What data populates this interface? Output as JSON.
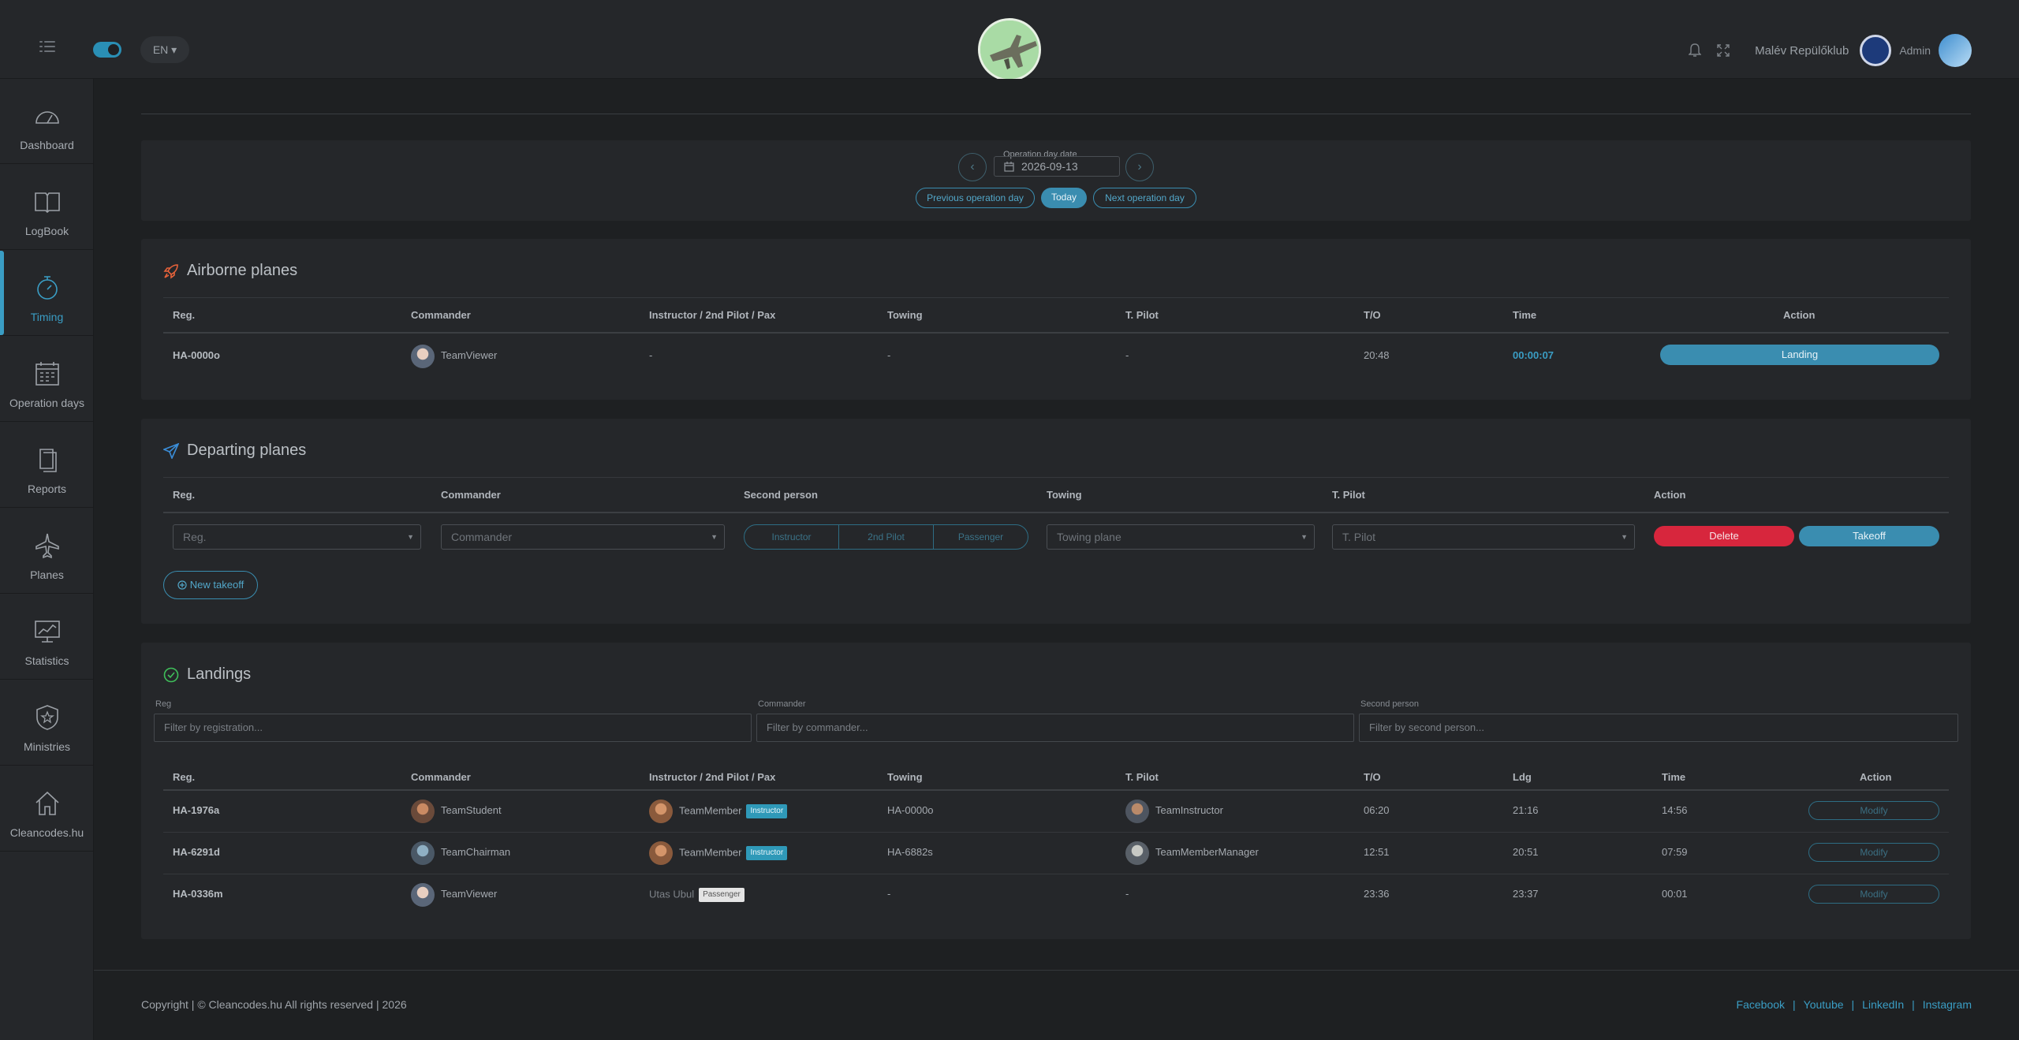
{
  "topbar": {
    "language": "EN",
    "club_name": "Malév Repülőklub",
    "user_role": "Admin"
  },
  "sidebar": {
    "items": [
      {
        "label": "Dashboard",
        "icon": "gauge-icon",
        "active": false
      },
      {
        "label": "LogBook",
        "icon": "book-icon",
        "active": false
      },
      {
        "label": "Timing",
        "icon": "stopwatch-icon",
        "active": true
      },
      {
        "label": "Operation days",
        "icon": "calendar-icon",
        "active": false
      },
      {
        "label": "Reports",
        "icon": "documents-icon",
        "active": false
      },
      {
        "label": "Planes",
        "icon": "plane-icon",
        "active": false
      },
      {
        "label": "Statistics",
        "icon": "chart-monitor-icon",
        "active": false
      },
      {
        "label": "Ministries",
        "icon": "shield-star-icon",
        "active": false
      },
      {
        "label": "Cleancodes.hu",
        "icon": "house-icon",
        "active": false
      }
    ]
  },
  "operation_day": {
    "label": "Operation day date",
    "date": "2026-09-13",
    "prev_label": "Previous operation day",
    "today_label": "Today",
    "next_label": "Next operation day"
  },
  "airborne": {
    "title": "Airborne planes",
    "columns": [
      "Reg.",
      "Commander",
      "Instructor / 2nd Pilot / Pax",
      "Towing",
      "T. Pilot",
      "T/O",
      "Time",
      "Action"
    ],
    "rows": [
      {
        "reg": "HA-0000o",
        "commander": "TeamViewer",
        "second": "-",
        "towing": "-",
        "tpilot": "-",
        "to": "20:48",
        "time": "00:00:07",
        "action": "Landing"
      }
    ]
  },
  "departing": {
    "title": "Departing planes",
    "columns": [
      "Reg.",
      "Commander",
      "Second person",
      "Towing",
      "T. Pilot",
      "Action"
    ],
    "reg_placeholder": "Reg.",
    "commander_placeholder": "Commander",
    "second_options": [
      "Instructor",
      "2nd Pilot",
      "Passenger"
    ],
    "towing_placeholder": "Towing plane",
    "tpilot_placeholder": "T. Pilot",
    "delete_label": "Delete",
    "takeoff_label": "Takeoff",
    "new_takeoff_label": "New takeoff"
  },
  "landings": {
    "title": "Landings",
    "filters": [
      {
        "label": "Reg",
        "placeholder": "Filter by registration..."
      },
      {
        "label": "Commander",
        "placeholder": "Filter by commander..."
      },
      {
        "label": "Second person",
        "placeholder": "Filter by second person..."
      }
    ],
    "columns": [
      "Reg.",
      "Commander",
      "Instructor / 2nd Pilot / Pax",
      "Towing",
      "T. Pilot",
      "T/O",
      "Ldg",
      "Time",
      "Action"
    ],
    "modify_label": "Modify",
    "rows": [
      {
        "reg": "HA-1976a",
        "commander": "TeamStudent",
        "second": "TeamMember",
        "badge": "Instructor",
        "towing": "HA-0000o",
        "tpilot": "TeamInstructor",
        "to": "06:20",
        "ldg": "21:16",
        "time": "14:56"
      },
      {
        "reg": "HA-6291d",
        "commander": "TeamChairman",
        "second": "TeamMember",
        "badge": "Instructor",
        "towing": "HA-6882s",
        "tpilot": "TeamMemberManager",
        "to": "12:51",
        "ldg": "20:51",
        "time": "07:59"
      },
      {
        "reg": "HA-0336m",
        "commander": "TeamViewer",
        "second": "Utas Ubul",
        "badge": "Passenger",
        "towing": "-",
        "tpilot": "-",
        "to": "23:36",
        "ldg": "23:37",
        "time": "00:01"
      }
    ]
  },
  "footer": {
    "copyright": "Copyright | © Cleancodes.hu All rights reserved | 2026",
    "links": [
      "Facebook",
      "Youtube",
      "LinkedIn",
      "Instagram"
    ]
  },
  "colors": {
    "accent": "#3a8db0",
    "danger": "#d7263d",
    "airborne_icon": "#e8623a",
    "departing_icon": "#3a8dd8",
    "landing_icon": "#3fbf5a"
  }
}
